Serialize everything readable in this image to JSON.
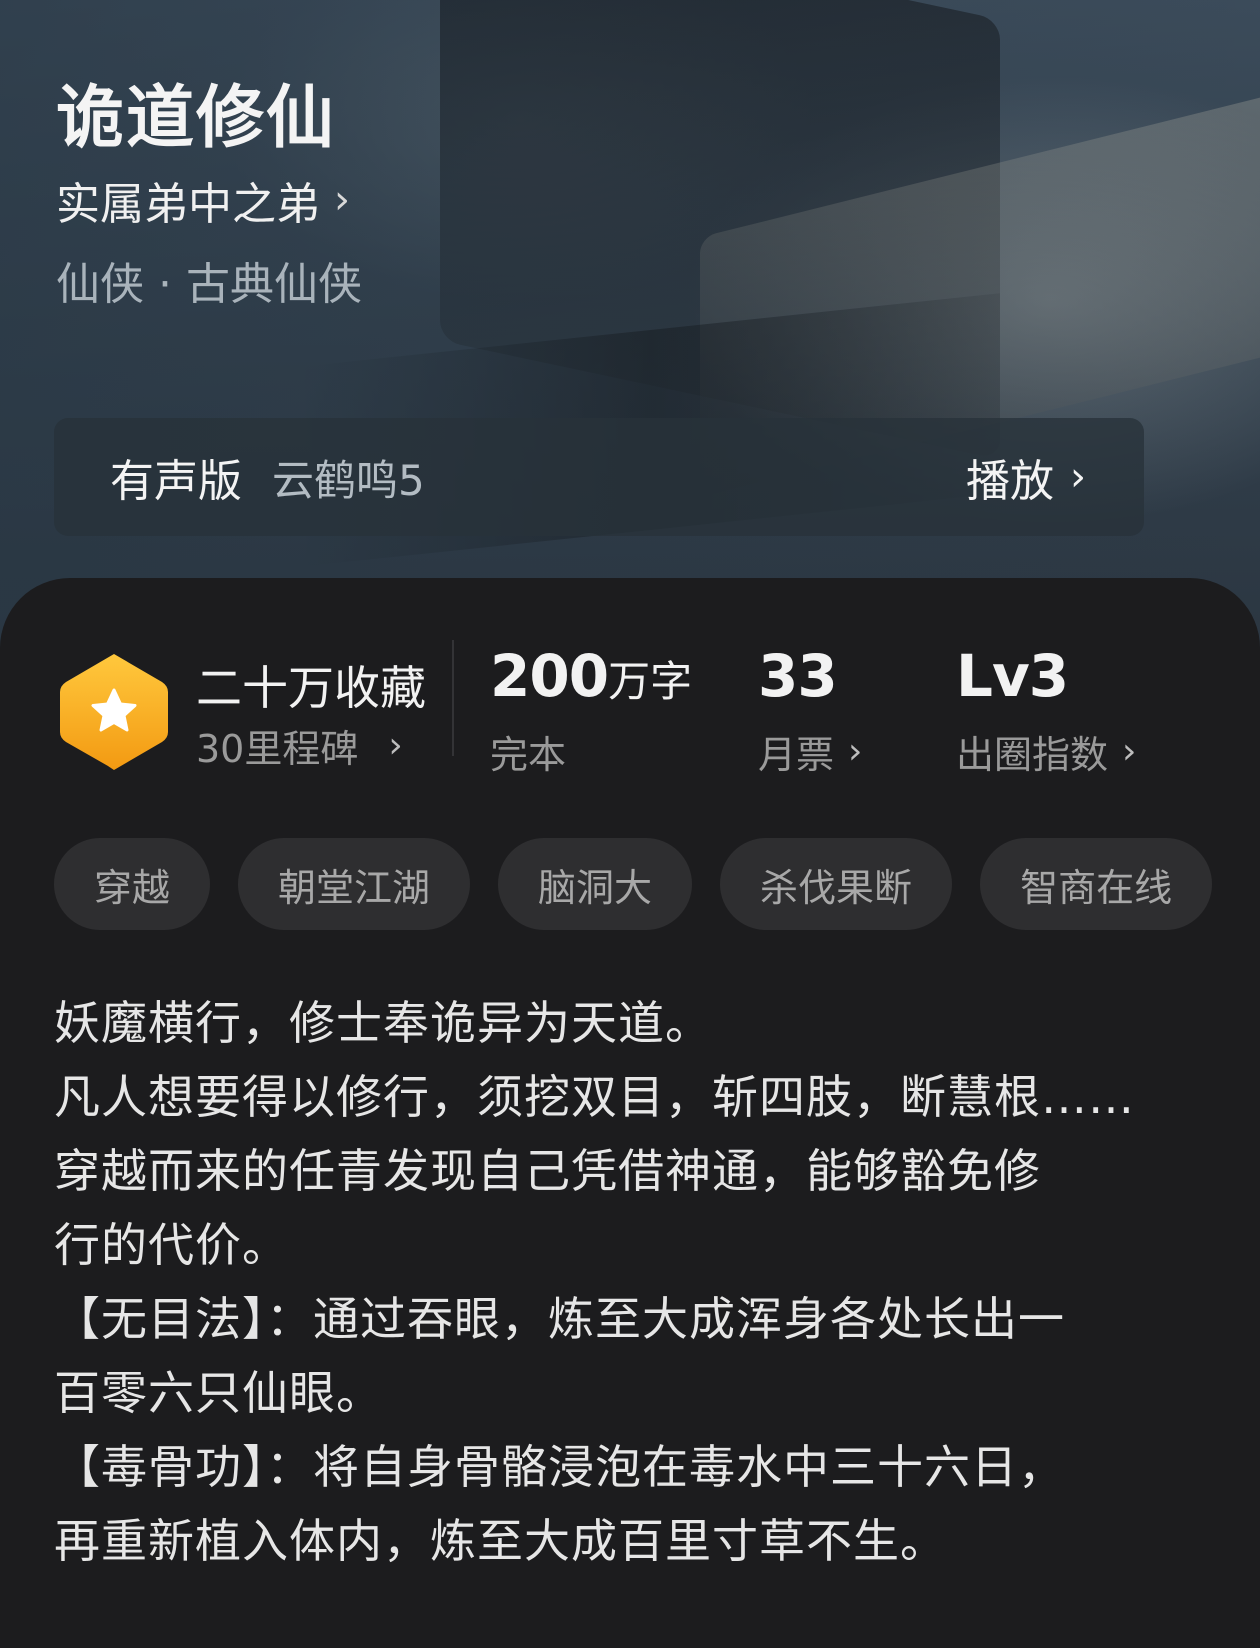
{
  "book": {
    "title": "诡道修仙",
    "author": "实属弟中之弟",
    "genre": "仙侠 · 古典仙侠"
  },
  "audio": {
    "label": "有声版",
    "narrator": "云鹤鸣5",
    "play_label": "播放"
  },
  "stats": {
    "collect_title": "二十万收藏",
    "collect_milestone": "30里程碑",
    "words_number": "200",
    "words_unit": "万字",
    "status": "完本",
    "monthly_tickets": "33",
    "monthly_tickets_label": "月票",
    "level": "Lv3",
    "level_label": "出圈指数"
  },
  "tags": [
    "穿越",
    "朝堂江湖",
    "脑洞大",
    "杀伐果断",
    "智商在线"
  ],
  "description": [
    "妖魔横行，修士奉诡异为天道。",
    "凡人想要得以修行，须挖双目，斩四肢，断慧根……",
    "穿越而来的任青发现自己凭借神通，能够豁免修",
    "行的代价。",
    "【无目法】：通过吞眼，炼至大成浑身各处长出一",
    "百零六只仙眼。",
    "【毒骨功】：将自身骨骼浸泡在毒水中三十六日，",
    "再重新植入体内，炼至大成百里寸草不生。"
  ],
  "colors": {
    "badge_gold": "#f5a623",
    "sheet_bg": "#1c1c1e",
    "tag_bg": "#2e2e30"
  }
}
